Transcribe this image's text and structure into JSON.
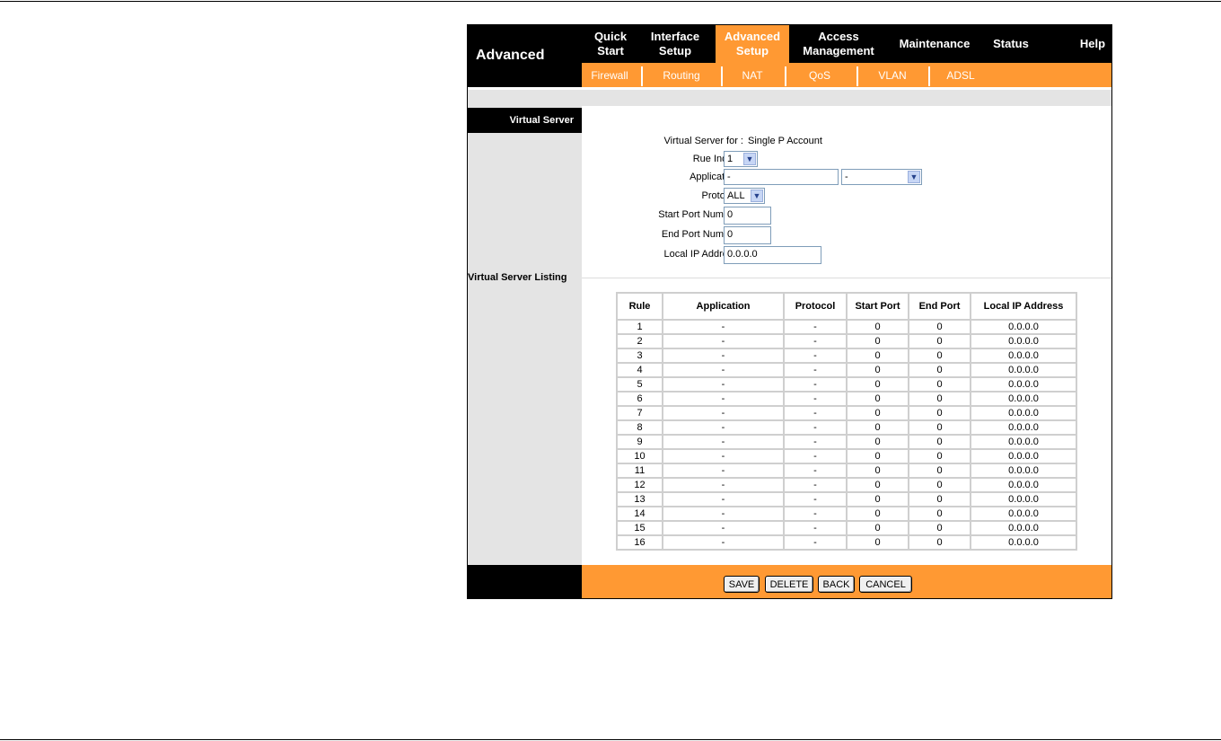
{
  "nav": {
    "brand": "Advanced",
    "items": [
      {
        "label": "Quick\nStart"
      },
      {
        "label": "Interface\nSetup"
      },
      {
        "label": "Advanced\nSetup"
      },
      {
        "label": "Access\nManagement"
      },
      {
        "label": "Maintenance"
      },
      {
        "label": "Status"
      },
      {
        "label": "Help"
      }
    ],
    "sub_items": [
      {
        "label": "Firewall"
      },
      {
        "label": "Routing"
      },
      {
        "label": "NAT"
      },
      {
        "label": "QoS"
      },
      {
        "label": "VLAN"
      },
      {
        "label": "ADSL"
      }
    ]
  },
  "sidebar": {
    "virtual_server": "Virtual Server",
    "listing": "Virtual Server Listing"
  },
  "form": {
    "vs_for_label": "Virtual Server for :",
    "vs_for_value": "Single P Account",
    "rule_index_label": "Rue Index :",
    "rule_index_value": "1",
    "application_label": "Application :",
    "application_value": "-",
    "application_select": "-",
    "protocol_label": "Protocol :",
    "protocol_value": "ALL",
    "start_port_label": "Start Port Number :",
    "start_port_value": "0",
    "end_port_label": "End Port Number :",
    "end_port_value": "0",
    "local_ip_label": "Local IP Address :",
    "local_ip_value": "0.0.0.0"
  },
  "table": {
    "headers": [
      "Rule",
      "Application",
      "Protocol",
      "Start Port",
      "End Port",
      "Local IP Address"
    ],
    "rows": [
      [
        "1",
        "-",
        "-",
        "0",
        "0",
        "0.0.0.0"
      ],
      [
        "2",
        "-",
        "-",
        "0",
        "0",
        "0.0.0.0"
      ],
      [
        "3",
        "-",
        "-",
        "0",
        "0",
        "0.0.0.0"
      ],
      [
        "4",
        "-",
        "-",
        "0",
        "0",
        "0.0.0.0"
      ],
      [
        "5",
        "-",
        "-",
        "0",
        "0",
        "0.0.0.0"
      ],
      [
        "6",
        "-",
        "-",
        "0",
        "0",
        "0.0.0.0"
      ],
      [
        "7",
        "-",
        "-",
        "0",
        "0",
        "0.0.0.0"
      ],
      [
        "8",
        "-",
        "-",
        "0",
        "0",
        "0.0.0.0"
      ],
      [
        "9",
        "-",
        "-",
        "0",
        "0",
        "0.0.0.0"
      ],
      [
        "10",
        "-",
        "-",
        "0",
        "0",
        "0.0.0.0"
      ],
      [
        "11",
        "-",
        "-",
        "0",
        "0",
        "0.0.0.0"
      ],
      [
        "12",
        "-",
        "-",
        "0",
        "0",
        "0.0.0.0"
      ],
      [
        "13",
        "-",
        "-",
        "0",
        "0",
        "0.0.0.0"
      ],
      [
        "14",
        "-",
        "-",
        "0",
        "0",
        "0.0.0.0"
      ],
      [
        "15",
        "-",
        "-",
        "0",
        "0",
        "0.0.0.0"
      ],
      [
        "16",
        "-",
        "-",
        "0",
        "0",
        "0.0.0.0"
      ]
    ]
  },
  "buttons": {
    "save": "SAVE",
    "delete": "DELETE",
    "back": "BACK",
    "cancel": "CANCEL"
  },
  "colors": {
    "accent": "#ff9933",
    "nav_bg": "#000000",
    "side_bg": "#e4e4e4"
  }
}
